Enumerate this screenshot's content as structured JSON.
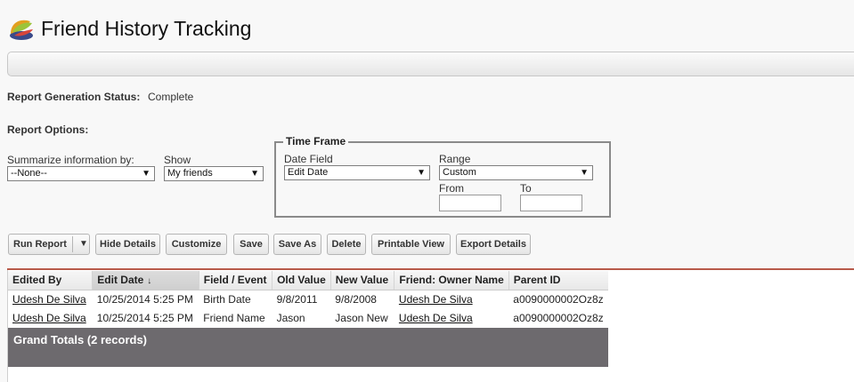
{
  "page": {
    "title": "Friend History Tracking",
    "icon": "report-logo-icon"
  },
  "status": {
    "label": "Report Generation Status:",
    "value": "Complete"
  },
  "options": {
    "label": "Report Options:",
    "summarize": {
      "label": "Summarize information by:",
      "value": "--None--"
    },
    "show": {
      "label": "Show",
      "value": "My friends"
    }
  },
  "time_frame": {
    "legend": "Time Frame",
    "date_field": {
      "label": "Date Field",
      "value": "Edit Date"
    },
    "range": {
      "label": "Range",
      "value": "Custom"
    },
    "from": {
      "label": "From",
      "value": ""
    },
    "to": {
      "label": "To",
      "value": ""
    }
  },
  "toolbar": {
    "run_report": "Run Report",
    "hide_details": "Hide Details",
    "customize": "Customize",
    "save": "Save",
    "save_as": "Save As",
    "delete": "Delete",
    "printable_view": "Printable View",
    "export_details": "Export Details"
  },
  "table": {
    "columns": [
      "Edited By",
      "Edit Date",
      "Field / Event",
      "Old Value",
      "New Value",
      "Friend: Owner Name",
      "Parent ID"
    ],
    "sorted_column": "Edit Date",
    "rows": [
      [
        "Udesh De Silva",
        "10/25/2014 5:25 PM",
        "Birth Date",
        "9/8/2011",
        "9/8/2008",
        "Udesh De Silva",
        "a0090000002Oz8z"
      ],
      [
        "Udesh De Silva",
        "10/25/2014 5:25 PM",
        "Friend Name",
        "Jason",
        "Jason New",
        "Udesh De Silva",
        "a0090000002Oz8z"
      ]
    ],
    "grand_totals": "Grand Totals (2 records)"
  },
  "colors": {
    "accent_line": "#b85a4a",
    "totals_bg": "#6d6a6e"
  }
}
